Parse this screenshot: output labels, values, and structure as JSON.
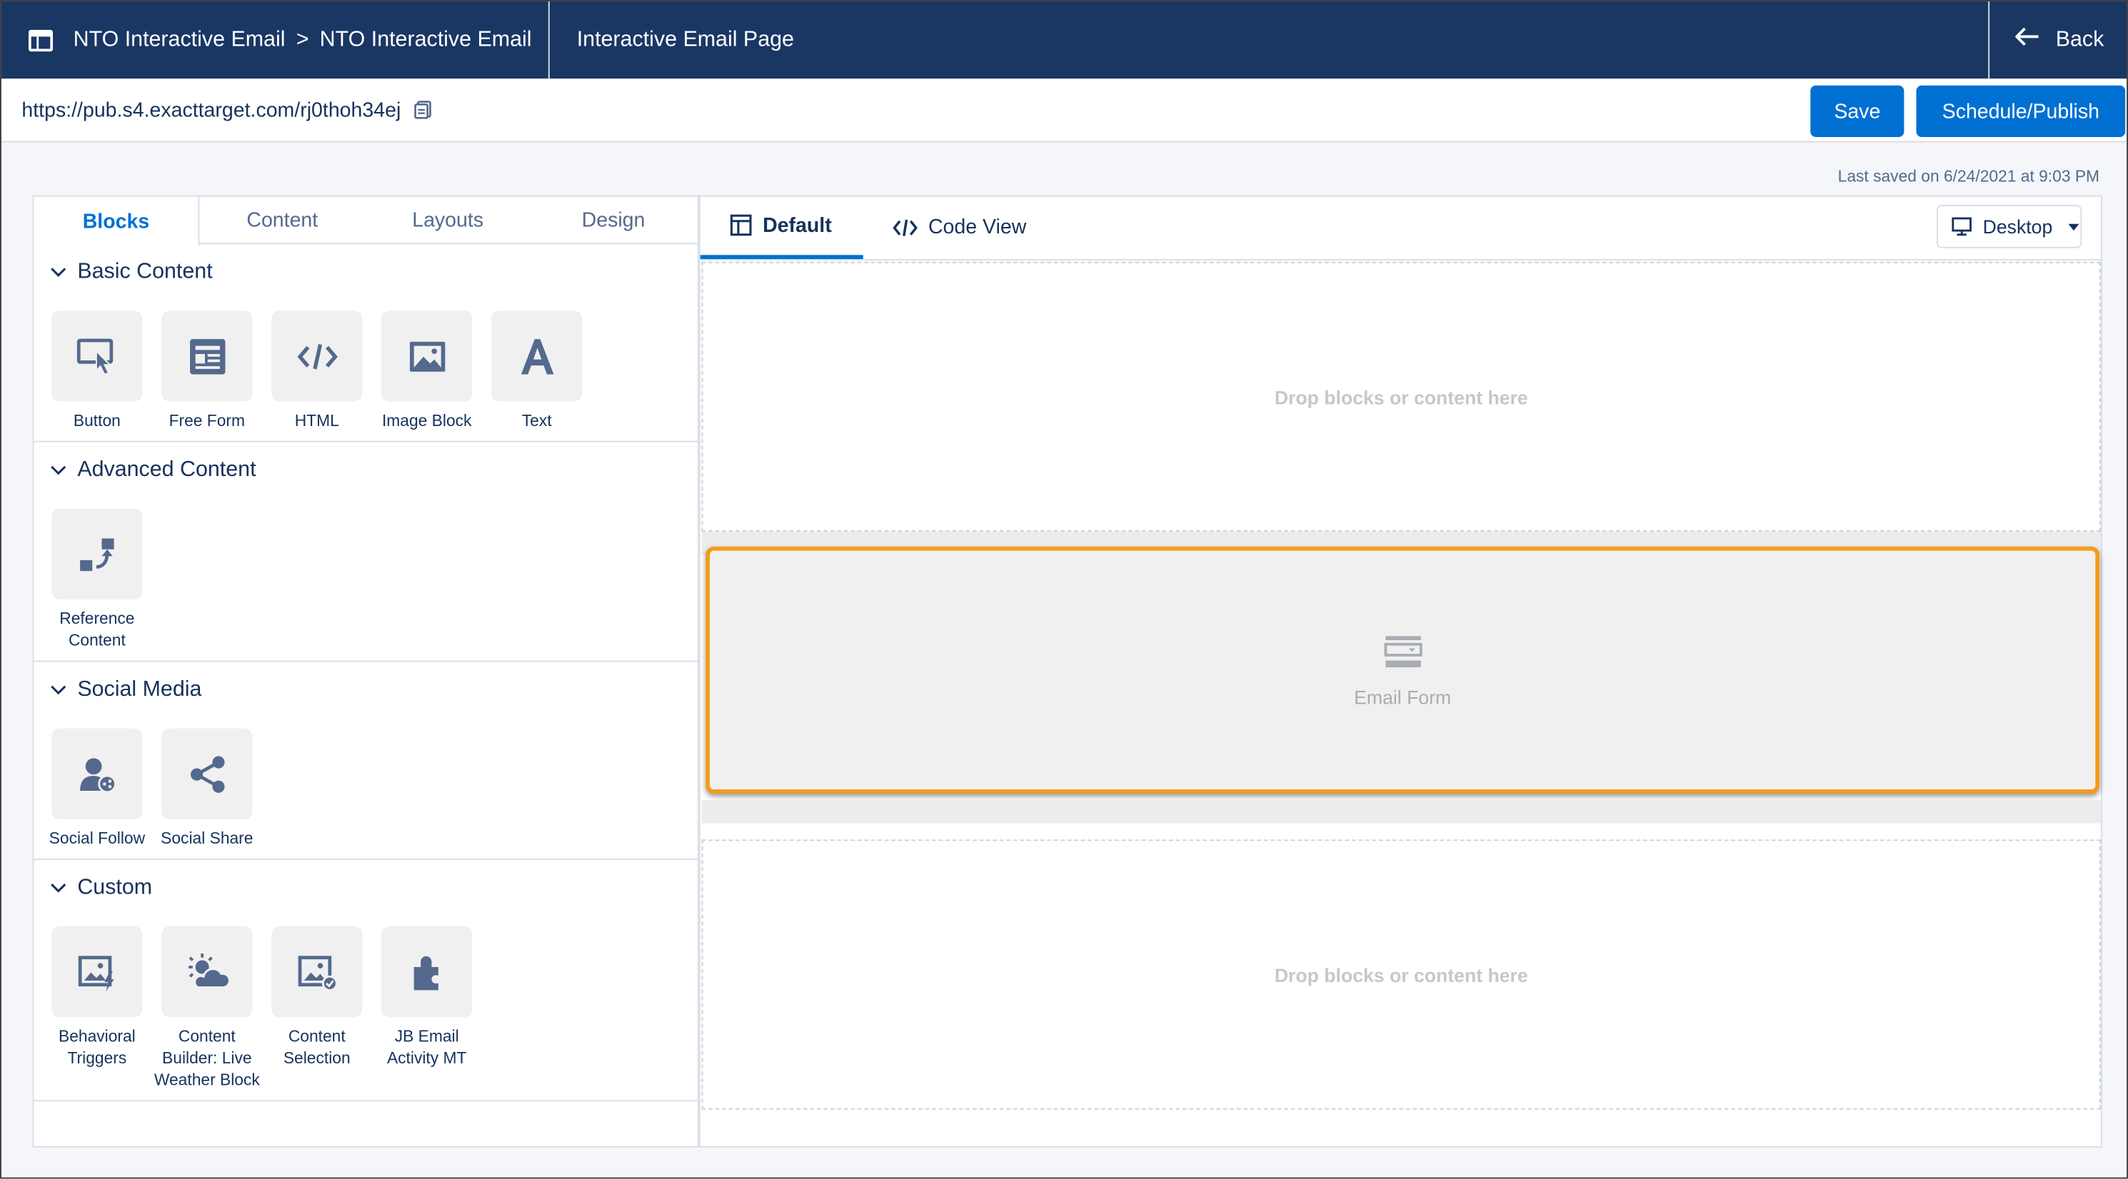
{
  "header": {
    "app_icon": "app-grid-icon",
    "crumb_1": "NTO Interactive Email",
    "separator": ">",
    "crumb_2": "NTO Interactive Email",
    "page_title": "Interactive Email Page",
    "back_label": "Back"
  },
  "url_bar": {
    "url": "https://pub.s4.exacttarget.com/rj0thoh34ej",
    "save_label": "Save",
    "publish_label": "Schedule/Publish"
  },
  "last_saved": "Last saved on 6/24/2021 at 9:03 PM",
  "left_panel": {
    "tabs": [
      "Blocks",
      "Content",
      "Layouts",
      "Design"
    ],
    "active_tab": "Blocks",
    "sections": [
      {
        "title": "Basic Content",
        "blocks": [
          {
            "label": "Button",
            "icon": "button-click-icon"
          },
          {
            "label": "Free Form",
            "icon": "free-form-icon"
          },
          {
            "label": "HTML",
            "icon": "html-code-icon"
          },
          {
            "label": "Image Block",
            "icon": "image-icon"
          },
          {
            "label": "Text",
            "icon": "text-icon"
          }
        ]
      },
      {
        "title": "Advanced Content",
        "blocks": [
          {
            "label": "Reference Content",
            "icon": "reference-content-icon"
          }
        ]
      },
      {
        "title": "Social Media",
        "blocks": [
          {
            "label": "Social Follow",
            "icon": "social-follow-icon"
          },
          {
            "label": "Social Share",
            "icon": "social-share-icon"
          }
        ]
      },
      {
        "title": "Custom",
        "blocks": [
          {
            "label": "Behavioral Triggers",
            "icon": "behavioral-triggers-icon"
          },
          {
            "label": "Content Builder: Live Weather Block",
            "icon": "weather-icon"
          },
          {
            "label": "Content Selection",
            "icon": "content-selection-icon"
          },
          {
            "label": "JB Email Activity MT",
            "icon": "puzzle-icon"
          }
        ]
      }
    ]
  },
  "canvas": {
    "tabs": [
      {
        "label": "Default",
        "icon": "layout-icon"
      },
      {
        "label": "Code View",
        "icon": "code-icon"
      }
    ],
    "active_tab": "Default",
    "device_label": "Desktop",
    "drop_text_1": "Drop blocks or content here",
    "email_form_label": "Email Form",
    "drop_text_2": "Drop blocks or content here"
  },
  "colors": {
    "header_bg": "#1a3764",
    "primary": "#0070d2",
    "selection": "#f39c1a"
  }
}
